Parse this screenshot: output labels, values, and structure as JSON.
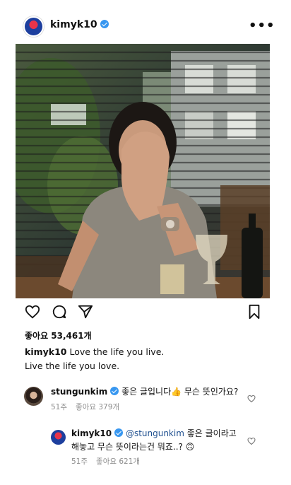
{
  "post": {
    "username": "kimyk10",
    "more_label": "•••"
  },
  "actions": {
    "like_icon": "heart-icon",
    "comment_icon": "comment-icon",
    "share_icon": "send-icon",
    "save_icon": "bookmark-icon"
  },
  "likes": {
    "text": "좋아요 53,461개"
  },
  "caption": {
    "username": "kimyk10",
    "line1": "Love the life you live.",
    "line2": "Live the life you love."
  },
  "comments": [
    {
      "username": "stungunkim",
      "text": "좋은 글입니다👍 무슨 뜻인가요?",
      "time": "51주",
      "likes": "좋아요 379개"
    },
    {
      "username": "kimyk10",
      "mention": "@stungunkim",
      "text1": " 좋은 글이라고",
      "text2": "해놓고 무슨 뜻이라는건 뭐죠..? 🙃",
      "time": "51주",
      "likes": "좋아요 621개"
    }
  ],
  "colors": {
    "verified": "#3897f0",
    "meta_gray": "#8e8e8e"
  }
}
